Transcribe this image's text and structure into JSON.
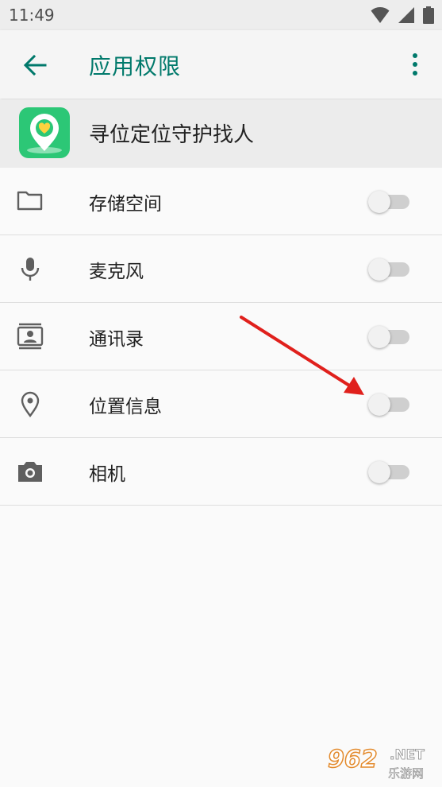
{
  "status_bar": {
    "time": "11:49",
    "icons": [
      "wifi-icon",
      "signal-icon",
      "battery-icon"
    ]
  },
  "toolbar": {
    "title": "应用权限",
    "back_icon": "arrow-back-icon",
    "more_icon": "more-vert-icon",
    "accent_color": "#00796b"
  },
  "app": {
    "name": "寻位定位守护找人",
    "icon": "location-heart-app-icon",
    "icon_color": "#2cc776"
  },
  "permissions": [
    {
      "label": "存储空间",
      "icon": "folder-icon",
      "enabled": false
    },
    {
      "label": "麦克风",
      "icon": "microphone-icon",
      "enabled": false
    },
    {
      "label": "通讯录",
      "icon": "contacts-icon",
      "enabled": false
    },
    {
      "label": "位置信息",
      "icon": "location-pin-icon",
      "enabled": false
    },
    {
      "label": "相机",
      "icon": "camera-icon",
      "enabled": false
    }
  ],
  "annotation": {
    "arrow_color": "#e0201c"
  },
  "watermark": {
    "big": "962",
    "net": ".NET",
    "cn": "乐游网"
  }
}
